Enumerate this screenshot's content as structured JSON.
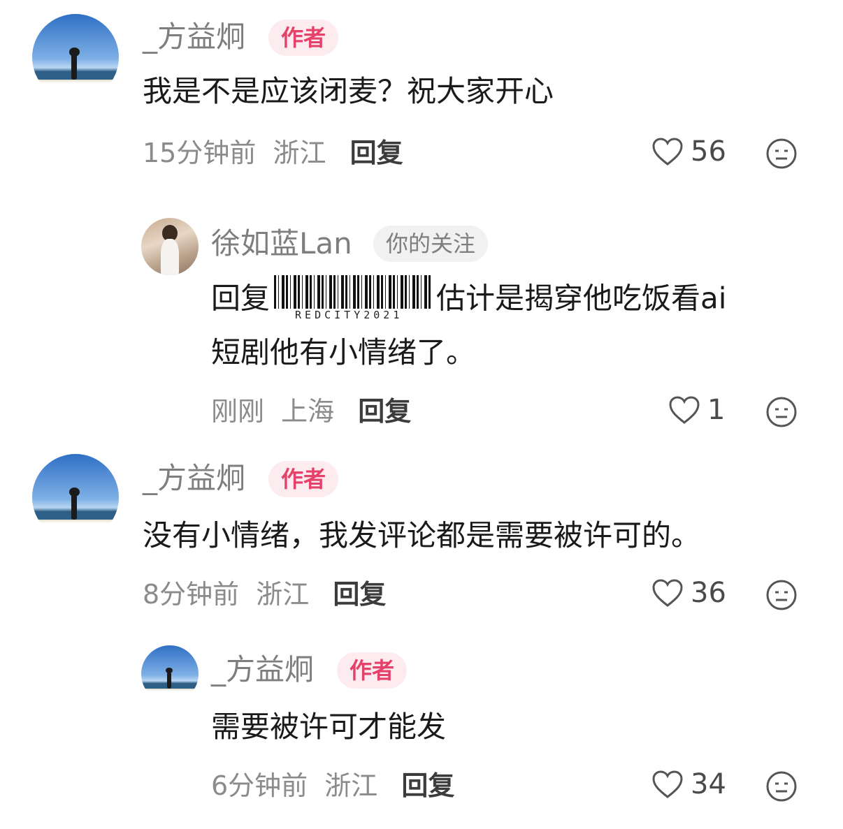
{
  "comments": [
    {
      "author": "_方益炯",
      "badge": "作者",
      "text": "我是不是应该闭麦？祝大家开心",
      "time": "15分钟前",
      "location": "浙江",
      "reply_label": "回复",
      "likes": "56"
    },
    {
      "author": "徐如蓝Lan",
      "badge": "你的关注",
      "reply_prefix": "回复",
      "text": "估计是揭穿他吃饭看ai",
      "text_line2": "短剧他有小情绪了。",
      "barcode_text": "REDCITY2021",
      "time": "刚刚",
      "location": "上海",
      "reply_label": "回复",
      "likes": "1"
    },
    {
      "author": "_方益炯",
      "badge": "作者",
      "text": "没有小情绪，我发评论都是需要被许可的。",
      "time": "8分钟前",
      "location": "浙江",
      "reply_label": "回复",
      "likes": "36"
    },
    {
      "author": "_方益炯",
      "badge": "作者",
      "text": "需要被许可才能发",
      "time": "6分钟前",
      "location": "浙江",
      "reply_label": "回复",
      "likes": "34"
    }
  ],
  "colors": {
    "author_badge": "#e4426a",
    "text": "#1a1a1a",
    "meta": "#8b8b8b"
  },
  "icons": [
    "heart-icon",
    "emoji-icon"
  ]
}
